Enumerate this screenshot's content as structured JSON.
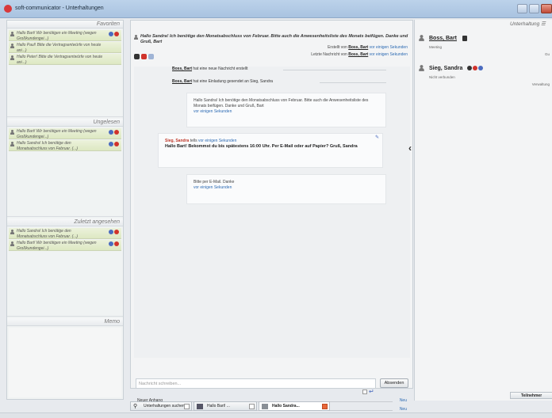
{
  "window": {
    "title": "soft-communicator - Unterhaltungen"
  },
  "left": {
    "favoriten": {
      "title": "Favoriten",
      "items": [
        {
          "text": "Hallo Bart! Wir benötigen ein Meeting (wegen Großkundengei...)"
        },
        {
          "text": "Hallo Paul! Bitte die Vertragsentwürfe von heute ani...)"
        },
        {
          "text": "Hallo Peter! Bitte die Vertragsentwürfe von heute ani...)"
        }
      ]
    },
    "ungelesen": {
      "title": "Ungelesen",
      "items": [
        {
          "text": "Hallo Bart! Wir benötigen ein Meeting (wegen Großkundengei...)"
        },
        {
          "text": "Hallo Sandra! Ich benötige den Monatsabschluss von Februar. (...)"
        }
      ]
    },
    "zuletzt": {
      "title": "Zuletzt angesehen",
      "items": [
        {
          "text": "Hallo Sandra! Ich benötige den Monatsabschluss von Februar. (...)"
        },
        {
          "text": "Hallo Bart! Wir benötigen ein Meeting (wegen Großkundengei...)"
        }
      ]
    },
    "memo": {
      "title": "Memo"
    }
  },
  "conversation": {
    "subject": "Hallo Sandra! Ich benötige den Monatsabschluss von Februar. Bitte auch die Anwesenheitsliste des Monats beifügen. Danke und Gruß, Bart",
    "created": {
      "prefix": "Erstellt von",
      "name": "Boss, Bart",
      "time": "vor einigen Sekunden"
    },
    "last": {
      "prefix": "Letzte Nachricht von",
      "name": "Boss, Bart",
      "time": "vor einigen Sekunden"
    },
    "events": [
      {
        "name": "Boss, Bart",
        "text": "hat eine neue Nachricht erstellt"
      },
      {
        "name": "Boss, Bart",
        "text": "hat eine Einladung gesendet an Sieg, Sandra"
      }
    ],
    "messages": [
      {
        "body": "Hallo Sandra! Ich benötige den Monatsabschluss von Februar. Bitte auch die Anwesenheitsliste des Monats beifügen. Danke und Gruß, Bart",
        "time": "vor einigen Sekunden"
      },
      {
        "sender": "Sieg, Sandra",
        "infix": "tells",
        "time": "vor einigen Sekunden",
        "body": "Hallo Bart! Bekommst du bis spätestens 16:00 Uhr. Per E-Mail oder auf Papier? Gruß, Sandra"
      },
      {
        "body": "Bitte per E-Mail. Danke",
        "time": "vor einigen Sekunden"
      }
    ],
    "compose_placeholder": "Nachricht schreiben...",
    "send_label": "Absenden",
    "attachment_label": "Neuer Anhang",
    "attachment_link": "Neu",
    "participant_label": "Neue Teilnehmer",
    "participant_link": "Neu"
  },
  "tabs": [
    {
      "label": "Unterhaltungen suchen"
    },
    {
      "label": "Hallo Bart! ..."
    },
    {
      "label": "Hallo Sandra..."
    }
  ],
  "right": {
    "tab_label": "Unterhaltung",
    "participants": [
      {
        "name": "Boss, Bart",
        "status": "Meeting",
        "extra": "Gu"
      },
      {
        "name": "Sieg, Sandra",
        "status": "Nicht verbunden",
        "extra": "Verwaltung"
      }
    ],
    "teilnehmer_label": "Teilnehmer"
  },
  "colors": {
    "accent_red": "#d0332c",
    "accent_blue": "#4a6bbf",
    "link_blue": "#2d6bb3",
    "row_green": "#dde8c2"
  }
}
